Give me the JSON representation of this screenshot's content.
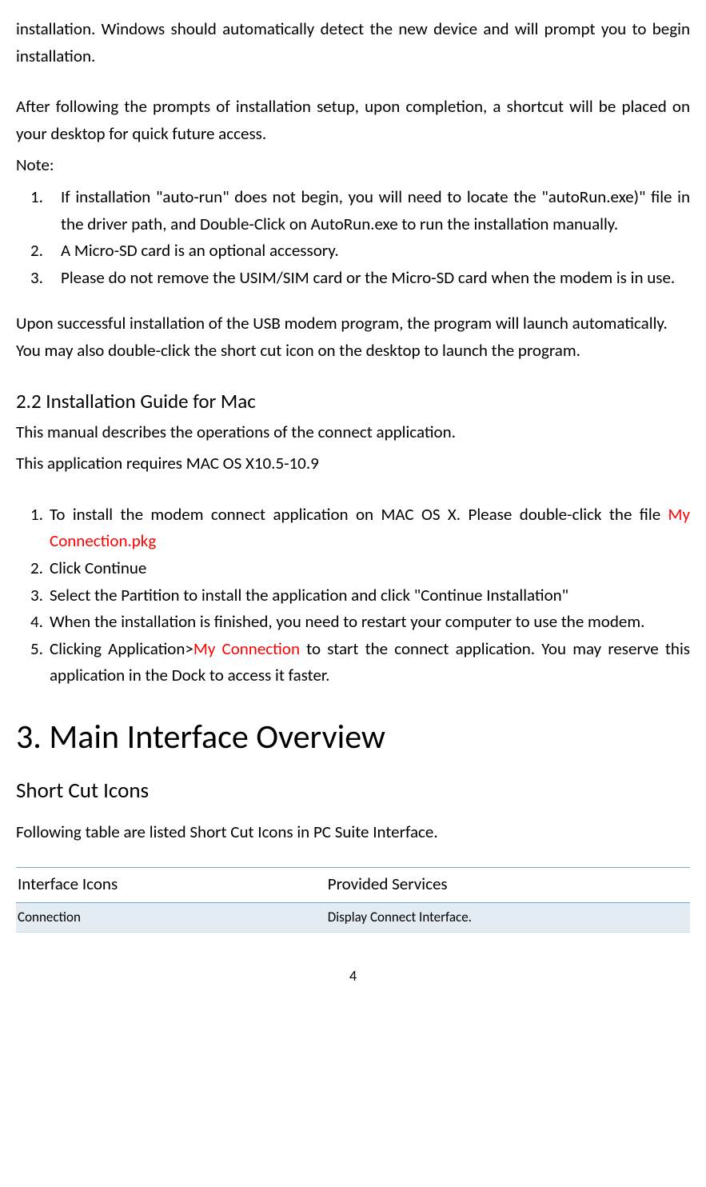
{
  "p1": "installation. Windows should automatically detect the new device and will prompt you to begin installation.",
  "p2": "After following the prompts of installation setup, upon completion, a shortcut will be placed on your desktop for quick future access.",
  "noteLabel": "Note:",
  "notes": [
    "If installation \"auto-run\" does not begin, you will need to locate the \"autoRun.exe)\" file in the driver path, and Double-Click on AutoRun.exe to run the installation manually.",
    "A Micro-SD card is an optional accessory.",
    "Please do not remove the USIM/SIM card or the Micro-SD card when the modem is in use."
  ],
  "p3": "Upon successful installation of the USB modem program, the program will launch automatically. You may also double-click the short cut icon on the desktop to launch the program.",
  "macHeading": "2.2 Installation Guide for Mac",
  "macIntro1": "This manual describes the operations of the connect application.",
  "macIntro2": "This application requires MAC OS X10.5-10.9",
  "macStep1a": "To install the modem connect application on MAC OS X. Please double-click the file ",
  "macStep1b": "My Connection.pkg",
  "macStep2": "Click Continue",
  "macStep3": "Select the Partition to install the application and click \"Continue Installation\"",
  "macStep4": "When the installation is finished, you need to restart your computer to use the modem.",
  "macStep5a": "Clicking Application>",
  "macStep5b": "My Connection",
  "macStep5c": " to start the connect application. You may reserve this application in the Dock to access it faster.",
  "mainHeading": "3. Main Interface Overview",
  "shortcutHeading": "Short Cut Icons",
  "shortcutIntro": "Following table are listed Short Cut Icons in PC Suite Interface.",
  "table": {
    "h1": "Interface Icons",
    "h2": "Provided Services",
    "r1c1": "Connection",
    "r1c2": "Display Connect Interface."
  },
  "pageNum": "4"
}
